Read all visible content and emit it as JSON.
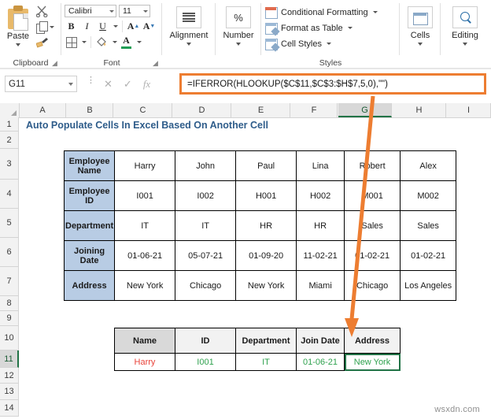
{
  "ribbon": {
    "groups": [
      {
        "label": "Clipboard",
        "name": "clipboard"
      },
      {
        "label": "Font",
        "name": "font"
      },
      {
        "label": "Alignment",
        "name": "alignment"
      },
      {
        "label": "Number",
        "name": "number"
      },
      {
        "label": "Styles",
        "name": "styles"
      },
      {
        "label": "Cells",
        "name": "cells"
      },
      {
        "label": "Editing",
        "name": "editing"
      }
    ],
    "clipboard": {
      "paste_label": "Paste",
      "cut_icon": "scissors-icon",
      "copy_icon": "copy-icon",
      "format_painter_icon": "format-painter-icon"
    },
    "font": {
      "font_name": "Calibri",
      "font_size": "11",
      "bold_label": "B",
      "italic_label": "I",
      "underline_label": "U",
      "increase_font_label": "A",
      "decrease_font_label": "A",
      "fill_color_label": "A",
      "font_color_accent": "#1f9d55"
    },
    "alignment": {
      "label": "Alignment"
    },
    "number": {
      "label": "Number",
      "format_symbol": "%"
    },
    "styles": {
      "conditional_formatting": "Conditional Formatting",
      "format_as_table": "Format as Table",
      "cell_styles": "Cell Styles"
    },
    "cells": {
      "label": "Cells"
    },
    "editing": {
      "label": "Editing"
    }
  },
  "formula_bar": {
    "name_box": "G11",
    "cancel_icon": "cancel-icon",
    "enter_icon": "confirm-icon",
    "fx_label": "fx",
    "formula": "=IFERROR(HLOOKUP($C$11,$C$3:$H$7,5,0),\"\")",
    "highlight_color": "#ED7D31"
  },
  "grid": {
    "columns": [
      "A",
      "B",
      "C",
      "D",
      "E",
      "F",
      "G",
      "H",
      "I"
    ],
    "selected_column": "G",
    "rows": [
      "1",
      "2",
      "3",
      "4",
      "5",
      "6",
      "7",
      "8",
      "9",
      "10",
      "11",
      "12",
      "13",
      "14"
    ],
    "selected_row": "11",
    "title": "Auto Populate Cells In Excel Based On Another Cell"
  },
  "employee_table": {
    "row_headers": [
      "Employee Name",
      "Employee ID",
      "Department",
      "Joining Date",
      "Address"
    ],
    "columns": [
      {
        "name": "Harry",
        "id": "I001",
        "department": "IT",
        "joining_date": "01-06-21",
        "address": "New York"
      },
      {
        "name": "John",
        "id": "I002",
        "department": "IT",
        "joining_date": "05-07-21",
        "address": "Chicago"
      },
      {
        "name": "Paul",
        "id": "H001",
        "department": "HR",
        "joining_date": "01-09-20",
        "address": "New York"
      },
      {
        "name": "Lina",
        "id": "H002",
        "department": "HR",
        "joining_date": "11-02-21",
        "address": "Miami"
      },
      {
        "name": "Robert",
        "id": "M001",
        "department": "Sales",
        "joining_date": "01-02-21",
        "address": "Chicago"
      },
      {
        "name": "Alex",
        "id": "M002",
        "department": "Sales",
        "joining_date": "01-02-21",
        "address": "Los Angeles"
      }
    ]
  },
  "result_table": {
    "headers": [
      "Name",
      "ID",
      "Department",
      "Join Date",
      "Address"
    ],
    "values": [
      "Harry",
      "I001",
      "IT",
      "01-06-21",
      "New York"
    ],
    "lookup_color": "#e8433a",
    "result_color": "#2fa14e",
    "active_cell": "Address"
  },
  "watermark": "wsxdn.com"
}
